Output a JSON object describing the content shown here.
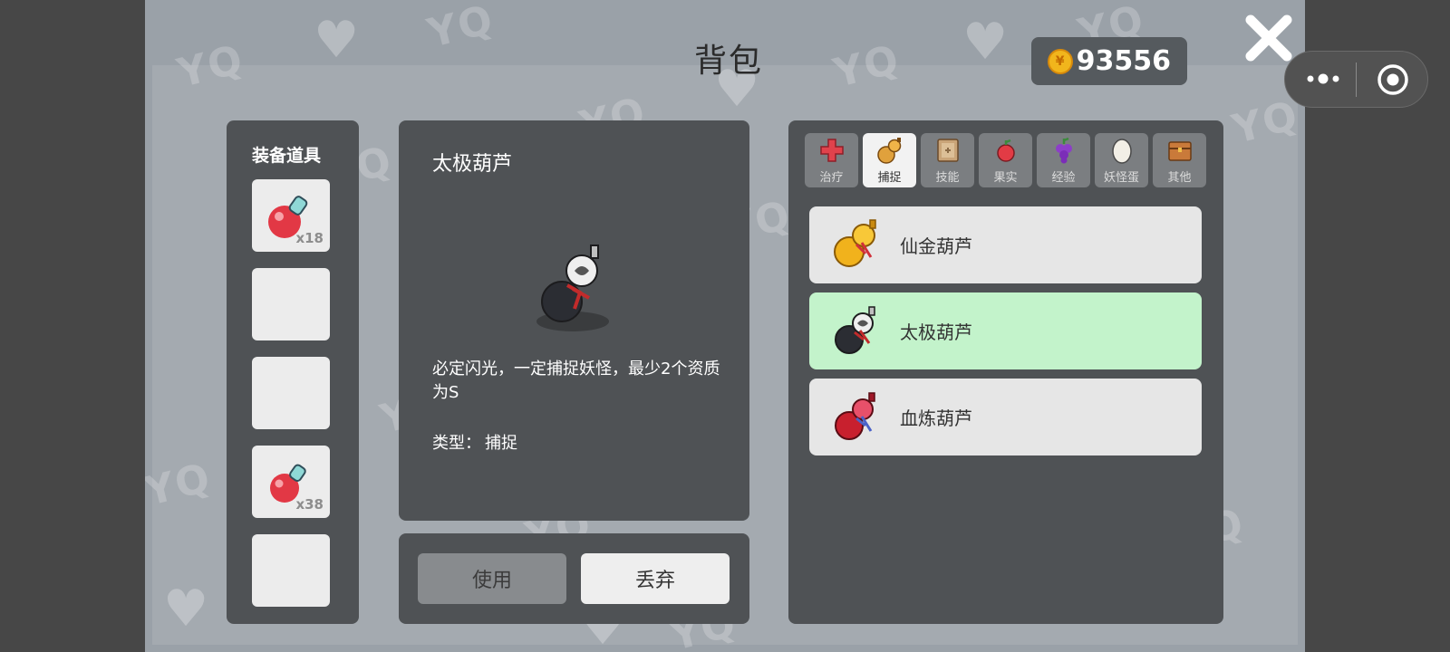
{
  "title": "背包",
  "coins": {
    "icon": "gold-coin-icon",
    "value": "93556"
  },
  "equip": {
    "title": "装备道具",
    "slots": [
      {
        "item": "red-potion-icon",
        "count": "x18"
      },
      {
        "item": "",
        "count": ""
      },
      {
        "item": "",
        "count": ""
      },
      {
        "item": "red-potion-icon",
        "count": "x38"
      },
      {
        "item": "",
        "count": ""
      }
    ]
  },
  "detail": {
    "name": "太极葫芦",
    "image": "taiji-gourd-icon",
    "description": "必定闪光，一定捕捉妖怪，最少2个资质为S",
    "type_label": "类型：",
    "type_value": "捕捉"
  },
  "actions": {
    "use": "使用",
    "drop": "丢弃"
  },
  "tabs": [
    {
      "label": "治疗",
      "icon": "red-cross-icon",
      "active": false
    },
    {
      "label": "捕捉",
      "icon": "gourd-icon",
      "active": true
    },
    {
      "label": "技能",
      "icon": "skill-book-icon",
      "active": false
    },
    {
      "label": "果实",
      "icon": "fruit-icon",
      "active": false
    },
    {
      "label": "经验",
      "icon": "grape-icon",
      "active": false
    },
    {
      "label": "妖怪蛋",
      "icon": "egg-icon",
      "active": false
    },
    {
      "label": "其他",
      "icon": "chest-icon",
      "active": false
    }
  ],
  "items": [
    {
      "name": "仙金葫芦",
      "icon": "golden-gourd-icon",
      "selected": false
    },
    {
      "name": "太极葫芦",
      "icon": "taiji-gourd-icon",
      "selected": true
    },
    {
      "name": "血炼葫芦",
      "icon": "blood-gourd-icon",
      "selected": false
    }
  ],
  "colors": {
    "selected_item": "#c3f3cb",
    "panel": "#4f5255",
    "background": "#9aa1a8"
  }
}
